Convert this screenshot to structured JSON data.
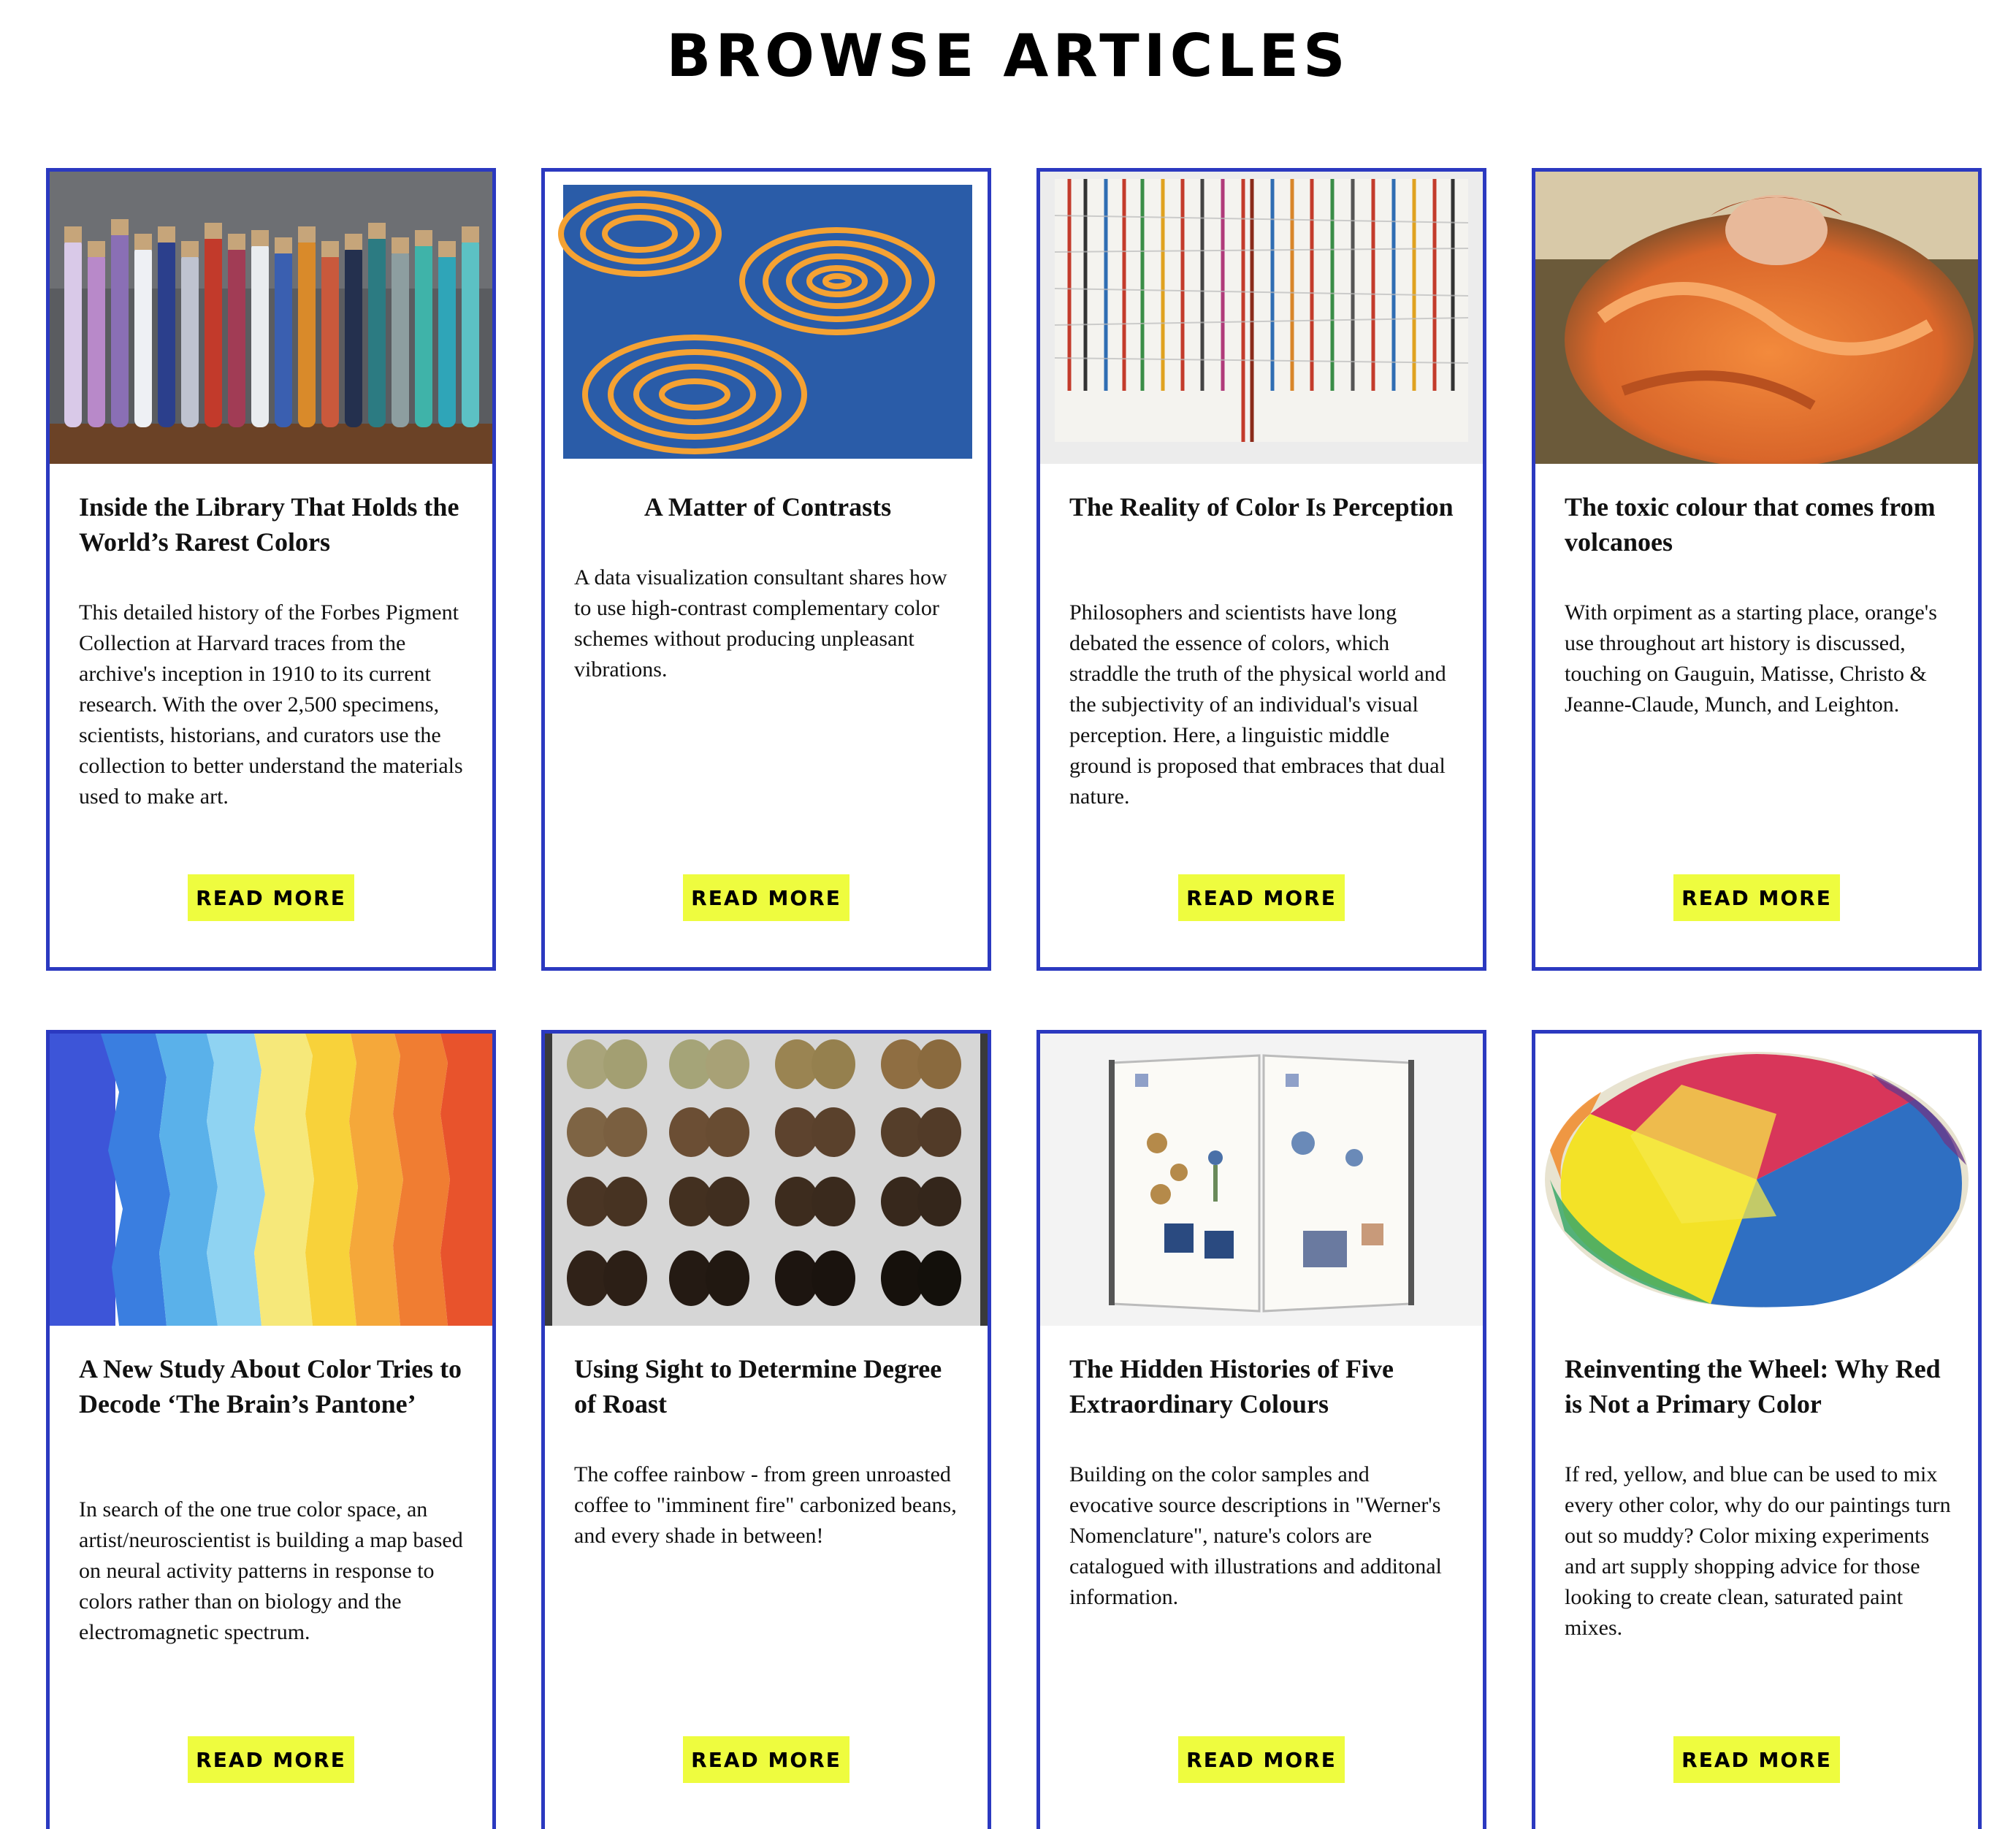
{
  "page": {
    "title": "BROWSE ARTICLES"
  },
  "colors": {
    "card_border": "#2b39c0",
    "button_bg": "#eefc3f"
  },
  "articles": [
    {
      "title": "Inside the Library That Holds the World’s Rarest Colors",
      "description": "This detailed history of the Forbes Pigment Collection at Harvard traces from the archive's inception in 1910 to its current research. With the over 2,500 specimens, scientists, historians, and curators use the collection to better understand the materials used to make art.",
      "button": "READ MORE"
    },
    {
      "title": "A Matter of Contrasts",
      "description": "A data visualization consultant shares how to use high-contrast complementary color schemes without producing unpleasant vibrations.",
      "button": "READ MORE"
    },
    {
      "title": "The Reality of Color Is Perception",
      "description": "Philosophers and scientists have long debated the essence of colors, which straddle the truth of the physical world and the subjectivity of an individual's visual perception. Here, a linguistic middle ground is proposed that embraces that dual nature.",
      "button": "READ MORE"
    },
    {
      "title": "The toxic colour that comes from volcanoes",
      "description": "With orpiment as a starting place, orange's use throughout art history is discussed, touching on Gauguin, Matisse, Christo & Jeanne-Claude, Munch, and Leighton.",
      "button": "READ MORE"
    },
    {
      "title": "A New Study About Color Tries to Decode ‘The Brain’s Pantone’",
      "description": "In search of the one true color space, an artist/neuroscientist is building a map based on neural activity patterns in response to colors rather than on biology and the electromagnetic spectrum.",
      "button": "READ MORE"
    },
    {
      "title": "Using Sight to Determine Degree of Roast",
      "description": "The coffee rainbow - from green unroasted coffee to \"imminent fire\" carbonized beans, and every shade in between!",
      "button": "READ MORE"
    },
    {
      "title": "The Hidden Histories of Five Extraordinary Colours",
      "description": "Building on the color samples and evocative source descriptions in \"Werner's Nomenclature\", nature's colors are catalogued with illustrations and additonal information.",
      "button": "READ MORE"
    },
    {
      "title": "Reinventing the Wheel: Why Red is Not a Primary Color",
      "description": "If red, yellow, and blue can be used to mix every other color, why do our paintings turn out so muddy? Color mixing experiments and art supply shopping advice for those looking to create clean, saturated paint mixes.",
      "button": "READ MORE"
    }
  ]
}
